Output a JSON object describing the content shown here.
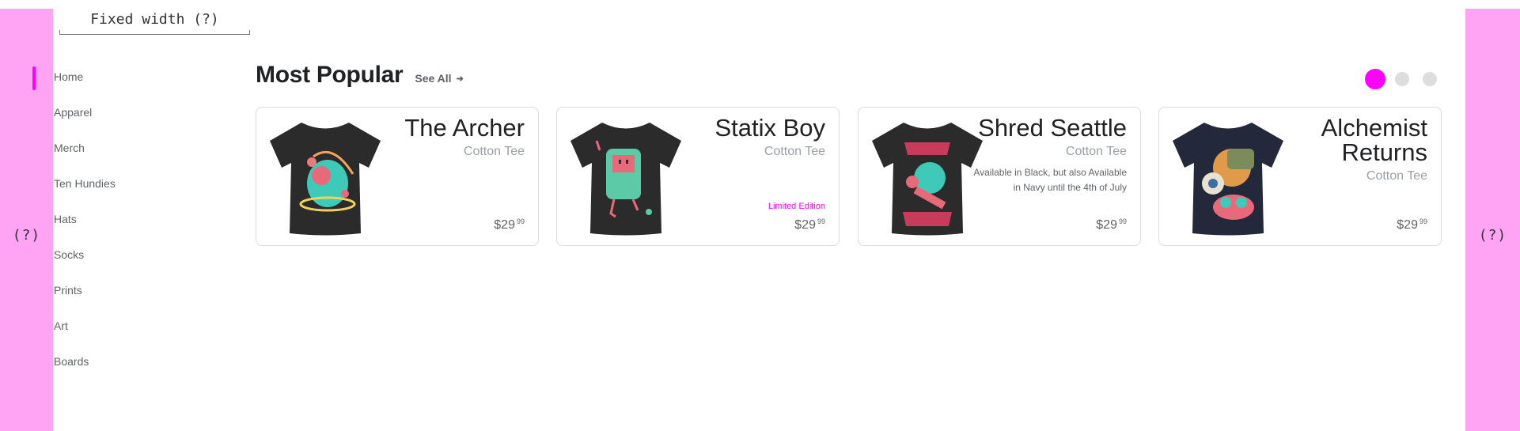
{
  "header": {
    "fixed_width_label": "Fixed width (?)"
  },
  "gutters": {
    "left_label": "(?)",
    "right_label": "(?)"
  },
  "sidebar": {
    "items": [
      {
        "label": "Home",
        "active": true
      },
      {
        "label": "Apparel"
      },
      {
        "label": "Merch"
      },
      {
        "label": "Ten Hundies"
      },
      {
        "label": "Hats"
      },
      {
        "label": "Socks"
      },
      {
        "label": "Prints"
      },
      {
        "label": "Art"
      },
      {
        "label": "Boards"
      }
    ]
  },
  "main": {
    "section_title": "Most Popular",
    "see_all_label": "See All",
    "see_all_icon": "arrow-right-icon",
    "carousel": {
      "page_count": 3,
      "active_page": 1
    },
    "products": [
      {
        "title": "The Archer",
        "subtitle": "Cotton Tee",
        "note": "",
        "badge": "",
        "price_dollars": "$29",
        "price_cents": "99",
        "shirt_color": "#2b2b2b"
      },
      {
        "title": "Statix Boy",
        "subtitle": "Cotton Tee",
        "note": "",
        "badge": "Limited Edition",
        "price_dollars": "$29",
        "price_cents": "99",
        "shirt_color": "#2b2b2b"
      },
      {
        "title": "Shred Seattle",
        "subtitle": "Cotton Tee",
        "note": "Available in Black, but also Available in Navy until the 4th of July",
        "badge": "",
        "price_dollars": "$29",
        "price_cents": "99",
        "shirt_color": "#2b2b2b"
      },
      {
        "title": "Alchemist Returns",
        "subtitle": "Cotton Tee",
        "note": "",
        "badge": "",
        "price_dollars": "$29",
        "price_cents": "99",
        "shirt_color": "#23293a"
      }
    ]
  },
  "colors": {
    "accent": "#ff00ff",
    "gutter": "#ffa4f4",
    "dot_inactive": "#dddddd"
  }
}
